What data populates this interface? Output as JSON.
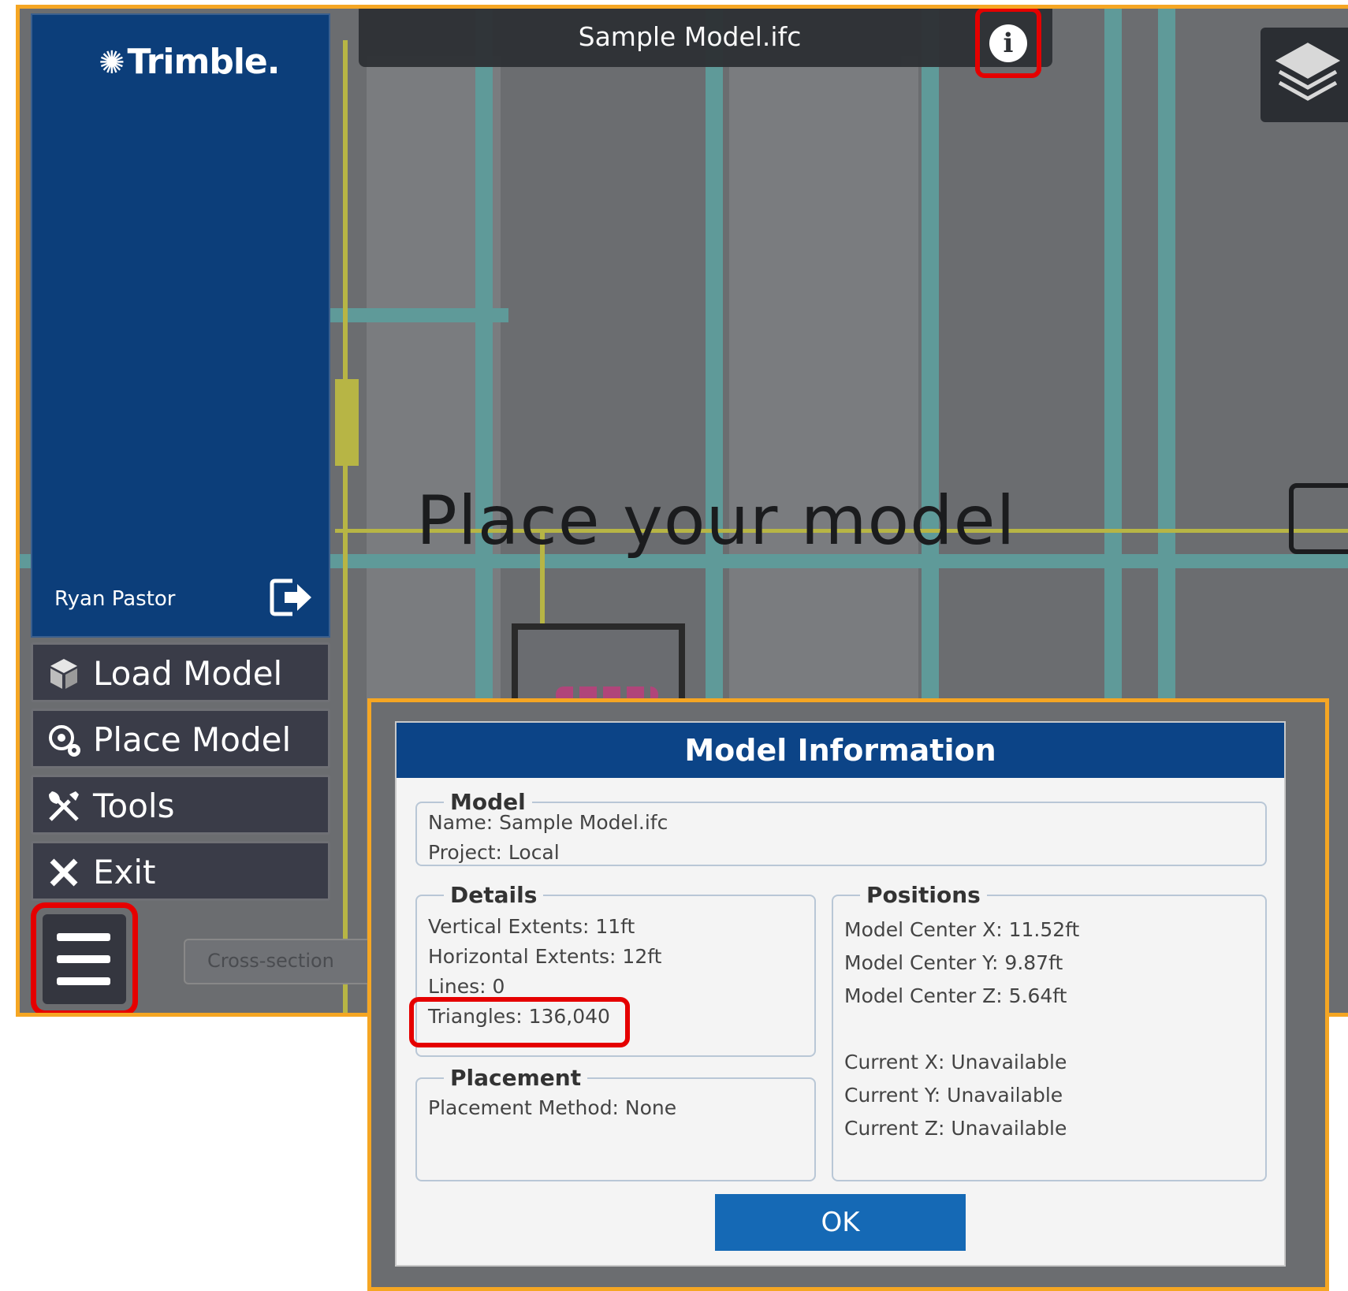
{
  "window": {
    "title": "Sample Model.ifc"
  },
  "viewport": {
    "prompt": "Place your model"
  },
  "sidebar": {
    "logo": "Trimble.",
    "user": "Ryan Pastor",
    "menu": [
      {
        "label": "Load Model",
        "icon": "cube-icon"
      },
      {
        "label": "Place Model",
        "icon": "place-icon"
      },
      {
        "label": "Tools",
        "icon": "tools-icon"
      },
      {
        "label": "Exit",
        "icon": "close-icon"
      }
    ]
  },
  "toolbar": {
    "cross_section": "Cross-section"
  },
  "dialog": {
    "title": "Model Information",
    "model": {
      "legend": "Model",
      "name": "Name: Sample Model.ifc",
      "project": "Project: Local"
    },
    "details": {
      "legend": "Details",
      "vertical": "Vertical Extents: 11ft",
      "horizontal": "Horizontal Extents: 12ft",
      "lines": "Lines: 0",
      "triangles": "Triangles: 136,040"
    },
    "placement": {
      "legend": "Placement",
      "method": "Placement Method: None"
    },
    "positions": {
      "legend": "Positions",
      "center_x": "Model Center X: 11.52ft",
      "center_y": "Model Center Y: 9.87ft",
      "center_z": "Model Center Z: 5.64ft",
      "current_x": "Current X: Unavailable",
      "current_y": "Current Y: Unavailable",
      "current_z": "Current Z: Unavailable"
    },
    "ok_label": "OK"
  },
  "colors": {
    "sidebar_blue": "#0c3e7a",
    "dialog_header": "#0c4487",
    "ok_button": "#1569b5",
    "highlight_red": "#e50000",
    "frame_orange": "#f5a623"
  }
}
